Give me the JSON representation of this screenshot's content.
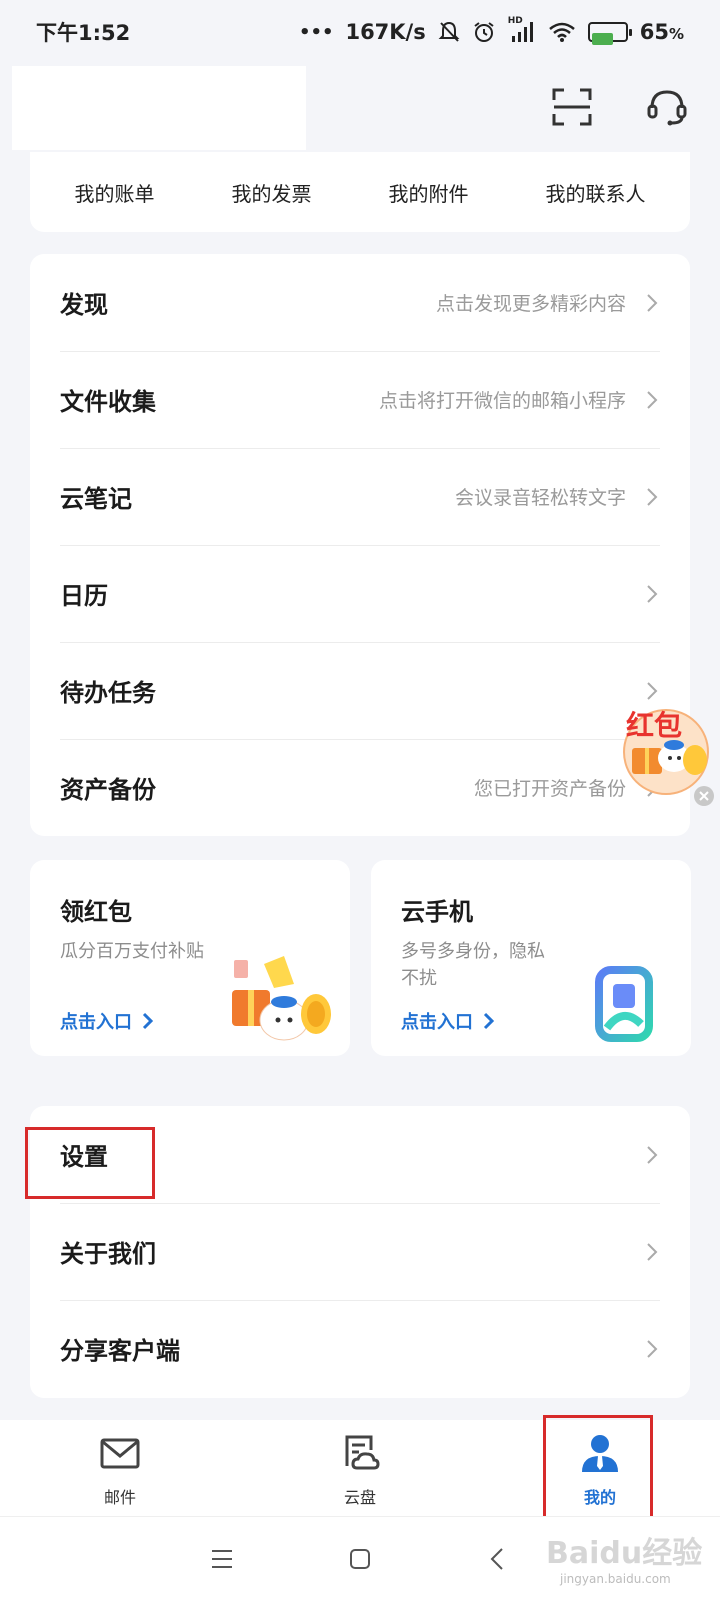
{
  "status_bar": {
    "time": "下午1:52",
    "network_speed": "167K/s",
    "dots": "•••",
    "hd_label": "HD",
    "battery_percent": "65",
    "percent_sign": "%",
    "battery_level": 0.65
  },
  "quick_links": [
    "我的账单",
    "我的发票",
    "我的附件",
    "我的联系人"
  ],
  "menu": [
    {
      "title": "发现",
      "subtitle": "点击发现更多精彩内容"
    },
    {
      "title": "文件收集",
      "subtitle": "点击将打开微信的邮箱小程序"
    },
    {
      "title": "云笔记",
      "subtitle": "会议录音轻松转文字"
    },
    {
      "title": "日历",
      "subtitle": ""
    },
    {
      "title": "待办任务",
      "subtitle": ""
    },
    {
      "title": "资产备份",
      "subtitle": "您已打开资产备份"
    }
  ],
  "promos": [
    {
      "title": "领红包",
      "desc": "瓜分百万支付补贴",
      "link": "点击入口"
    },
    {
      "title": "云手机",
      "desc": "多号多身份，隐私不扰",
      "link": "点击入口"
    }
  ],
  "floating_badge": {
    "label": "红包"
  },
  "settings_menu": [
    {
      "title": "设置"
    },
    {
      "title": "关于我们"
    },
    {
      "title": "分享客户端"
    }
  ],
  "bottom_nav": [
    {
      "label": "邮件",
      "icon": "mail-icon",
      "active": false
    },
    {
      "label": "云盘",
      "icon": "cloud-drive-icon",
      "active": false
    },
    {
      "label": "我的",
      "icon": "profile-icon",
      "active": true
    }
  ],
  "watermark": {
    "brand": "Baidu经验",
    "url": "jingyan.baidu.com"
  },
  "colors": {
    "accent": "#2272d3",
    "annotation": "#d72a2a",
    "badge": "#e8332e"
  }
}
